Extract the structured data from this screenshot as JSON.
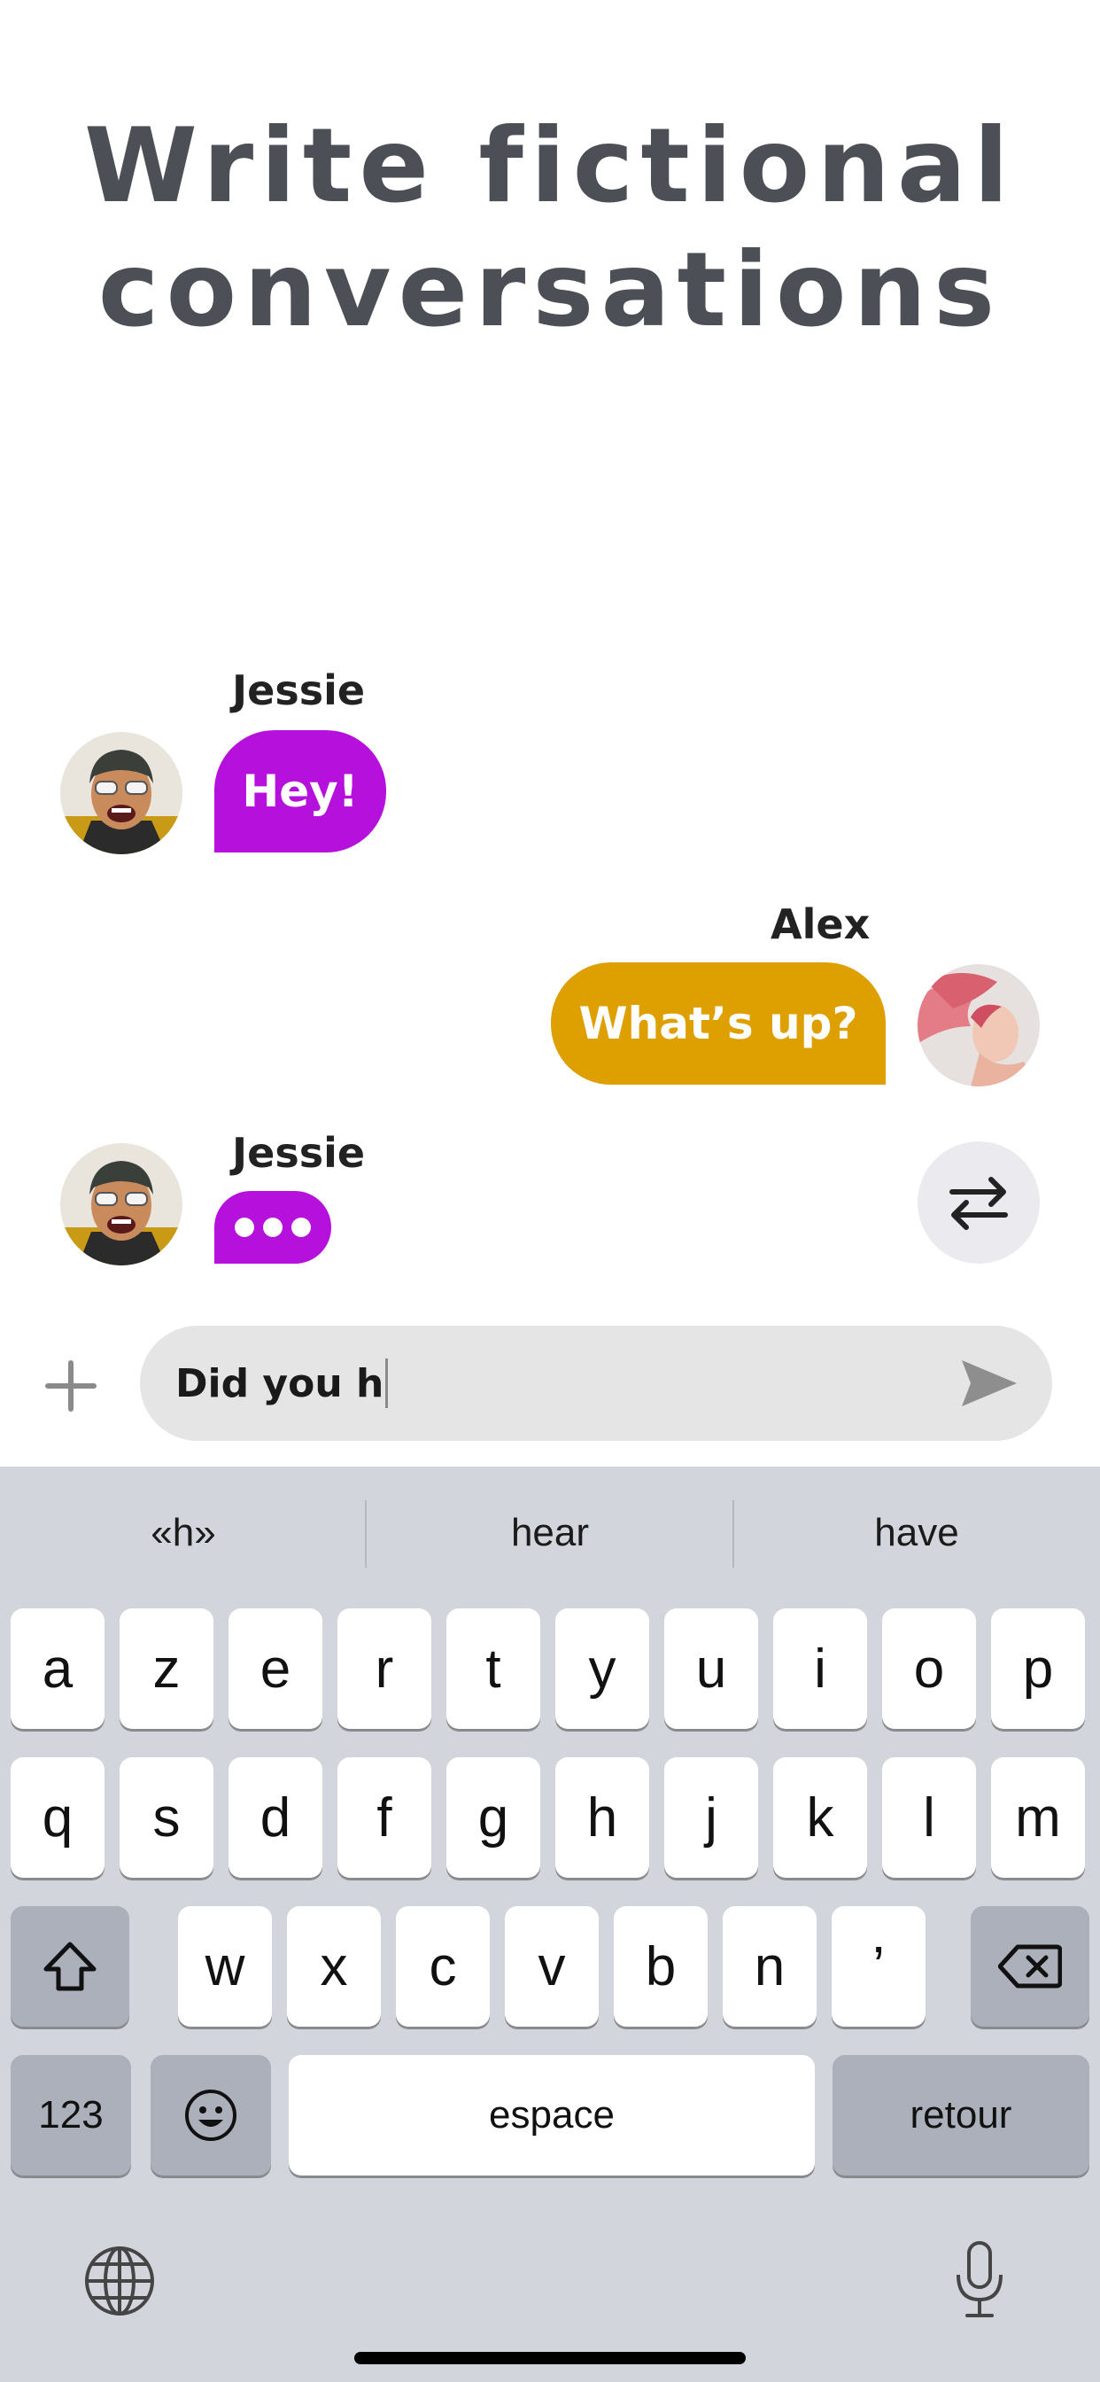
{
  "headline": {
    "line1": "Write fictional",
    "line2": "conversations"
  },
  "messages": [
    {
      "sender": "Jessie",
      "text": "Hey!",
      "side": "left",
      "color": "#b510dc"
    },
    {
      "sender": "Alex",
      "text": "What’s up?",
      "side": "right",
      "color": "#dea000"
    },
    {
      "sender": "Jessie",
      "text": "",
      "side": "left",
      "color": "#b510dc",
      "typing": true
    }
  ],
  "composer": {
    "text": "Did you h"
  },
  "keyboard": {
    "suggestions": [
      "«h»",
      "hear",
      "have"
    ],
    "row1": [
      "a",
      "z",
      "e",
      "r",
      "t",
      "y",
      "u",
      "i",
      "o",
      "p"
    ],
    "row2": [
      "q",
      "s",
      "d",
      "f",
      "g",
      "h",
      "j",
      "k",
      "l",
      "m"
    ],
    "row3": [
      "w",
      "x",
      "c",
      "v",
      "b",
      "n",
      "’"
    ],
    "numbers_label": "123",
    "space_label": "espace",
    "return_label": "retour"
  },
  "icons": {
    "swap": "swap-arrows-icon",
    "add": "plus-icon",
    "send": "send-icon",
    "shift": "shift-icon",
    "delete": "delete-icon",
    "emoji": "emoji-icon",
    "globe": "globe-icon",
    "mic": "microphone-icon"
  }
}
